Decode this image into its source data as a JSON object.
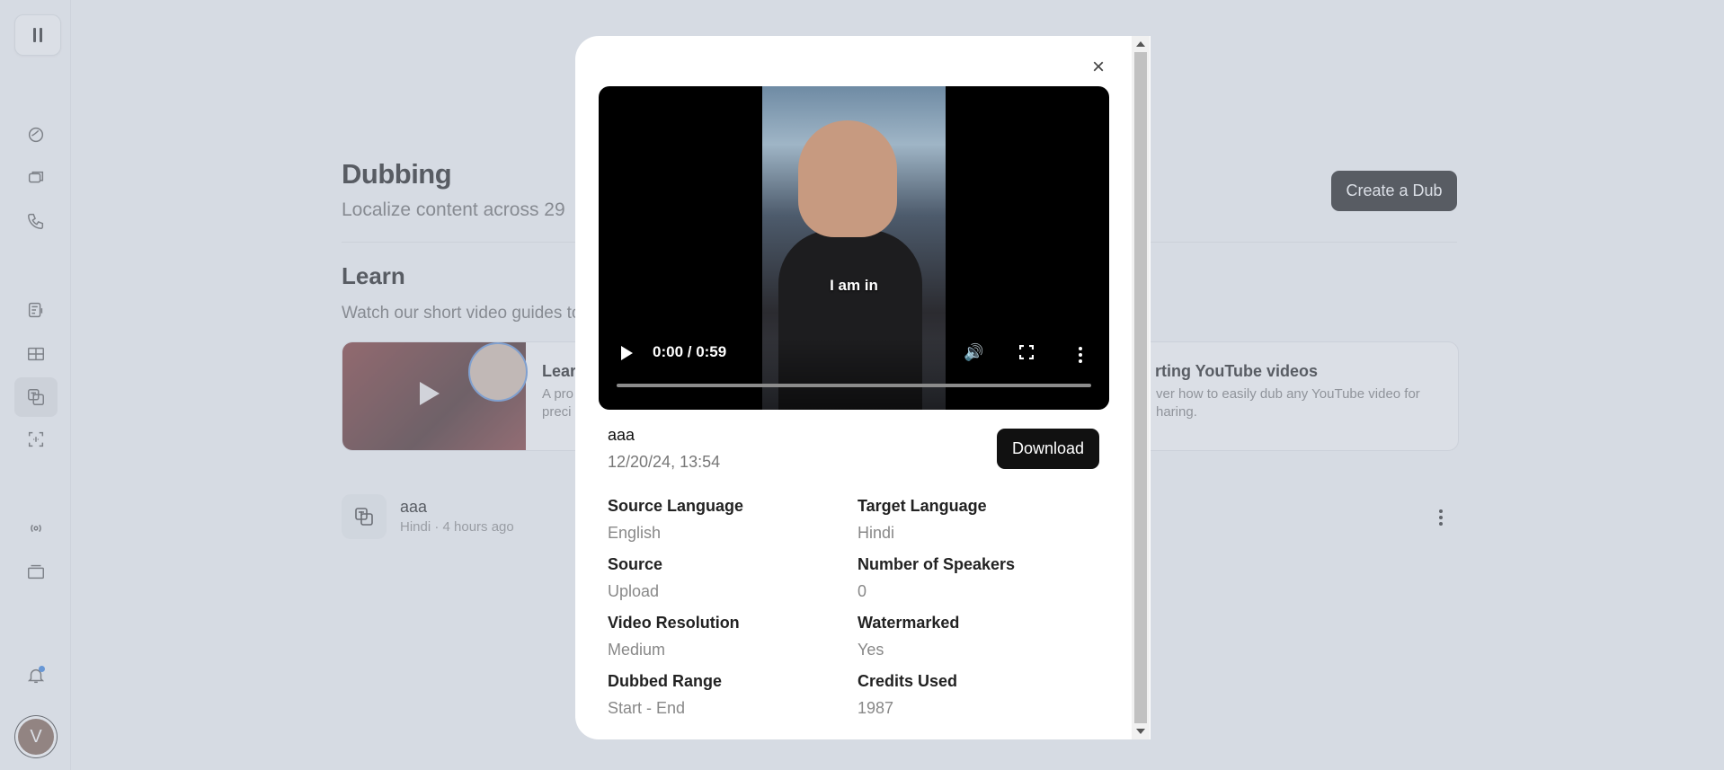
{
  "page": {
    "title": "Dubbing",
    "subtitle": "Localize content across 29",
    "create_label": "Create a Dub",
    "learn_title": "Learn",
    "learn_subtitle": "Watch our short video guides to"
  },
  "cards": [
    {
      "title": "Lear",
      "desc_line1": "A pro",
      "desc_line2": "preci"
    },
    {
      "title": "rting YouTube videos",
      "desc_line1": "ver how to easily dub any YouTube video for",
      "desc_line2": "haring."
    }
  ],
  "dub_item": {
    "name": "aaa",
    "meta": "Hindi · 4 hours ago"
  },
  "modal": {
    "close_symbol": "×",
    "video": {
      "caption": "I am in",
      "time": "0:00 / 0:59"
    },
    "dub_name": "aaa",
    "dub_date": "12/20/24, 13:54",
    "download_label": "Download",
    "fields": [
      {
        "label": "Source Language",
        "value": "English"
      },
      {
        "label": "Target Language",
        "value": "Hindi"
      },
      {
        "label": "Source",
        "value": "Upload"
      },
      {
        "label": "Number of Speakers",
        "value": "0"
      },
      {
        "label": "Video Resolution",
        "value": "Medium"
      },
      {
        "label": "Watermarked",
        "value": "Yes"
      },
      {
        "label": "Dubbed Range",
        "value": "Start - End"
      },
      {
        "label": "Credits Used",
        "value": "1987"
      }
    ]
  },
  "user": {
    "initial": "V"
  },
  "colors": {
    "accent": "#111111",
    "notification": "#2f7de1"
  },
  "sidebar_icons": [
    "sidebar-toggle-icon",
    "voices-icon",
    "conversations-icon",
    "phone-icon",
    "text-to-speech-icon",
    "studio-icon",
    "dubbing-icon",
    "voice-isolator-icon",
    "sound-effects-icon",
    "projects-icon",
    "bell-icon"
  ]
}
